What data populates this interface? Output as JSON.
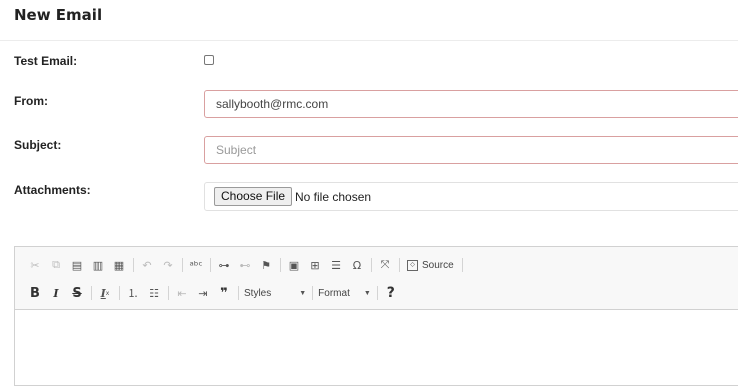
{
  "header": {
    "title": "New Email"
  },
  "form": {
    "test_email_label": "Test Email:",
    "from_label": "From:",
    "from_value": "sallybooth@rmc.com",
    "subject_label": "Subject:",
    "subject_placeholder": "Subject",
    "attachments_label": "Attachments:",
    "choose_file_label": "Choose File",
    "no_file_text": "No file chosen"
  },
  "editor": {
    "toolbar_row1": [
      "cut-icon",
      "copy-icon",
      "paste-icon",
      "paste-text-icon",
      "paste-word-icon",
      "undo-icon",
      "redo-icon",
      "spellcheck-icon",
      "link-icon",
      "unlink-icon",
      "anchor-icon",
      "image-icon",
      "table-icon",
      "horizontal-rule-icon",
      "special-char-icon",
      "maximize-icon",
      "source-icon"
    ],
    "source_label": "Source",
    "bold_glyph": "B",
    "italic_glyph": "I",
    "strike_glyph": "S",
    "styles_label": "Styles",
    "format_label": "Format",
    "help_glyph": "?"
  }
}
